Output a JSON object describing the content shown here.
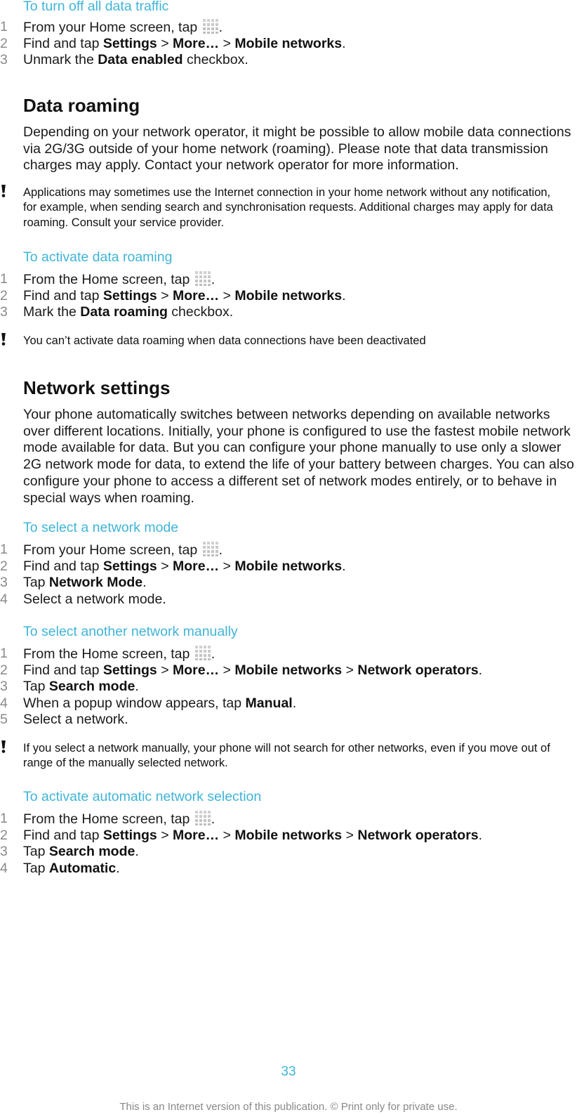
{
  "sections": {
    "turn_off": {
      "title": "To turn off all data traffic",
      "steps": [
        {
          "num": "1",
          "parts": [
            {
              "t": "From your Home screen, tap "
            },
            {
              "icon": "apps"
            },
            {
              "t": "."
            }
          ]
        },
        {
          "num": "2",
          "parts": [
            {
              "t": "Find and tap "
            },
            {
              "b": "Settings"
            },
            {
              "t": " > "
            },
            {
              "b": "More…"
            },
            {
              "t": " > "
            },
            {
              "b": "Mobile networks"
            },
            {
              "t": "."
            }
          ]
        },
        {
          "num": "3",
          "parts": [
            {
              "t": "Unmark the "
            },
            {
              "b": "Data enabled"
            },
            {
              "t": " checkbox."
            }
          ]
        }
      ]
    },
    "data_roaming": {
      "heading": "Data roaming",
      "paragraph": "Depending on your network operator, it might be possible to allow mobile data connections via 2G/3G outside of your home network (roaming). Please note that data transmission charges may apply. Contact your network operator for more information.",
      "note": "Applications may sometimes use the Internet connection in your home network without any notification, for example, when sending search and synchronisation requests. Additional charges may apply for data roaming. Consult your service provider."
    },
    "activate_roaming": {
      "title": "To activate data roaming",
      "steps": [
        {
          "num": "1",
          "parts": [
            {
              "t": "From the Home screen, tap "
            },
            {
              "icon": "apps"
            },
            {
              "t": "."
            }
          ]
        },
        {
          "num": "2",
          "parts": [
            {
              "t": "Find and tap "
            },
            {
              "b": "Settings"
            },
            {
              "t": " > "
            },
            {
              "b": "More…"
            },
            {
              "t": " > "
            },
            {
              "b": "Mobile networks"
            },
            {
              "t": "."
            }
          ]
        },
        {
          "num": "3",
          "parts": [
            {
              "t": "Mark the "
            },
            {
              "b": "Data roaming"
            },
            {
              "t": " checkbox."
            }
          ]
        }
      ],
      "note": "You can’t activate data roaming when data connections have been deactivated"
    },
    "network_settings": {
      "heading": "Network settings",
      "paragraph": "Your phone automatically switches between networks depending on available networks over different locations. Initially, your phone is configured to use the fastest mobile network mode available for data. But you can configure your phone manually to use only a slower 2G network mode for data, to extend the life of your battery between charges. You can also configure your phone to access a different set of network modes entirely, or to behave in special ways when roaming."
    },
    "select_mode": {
      "title": "To select a network mode",
      "steps": [
        {
          "num": "1",
          "parts": [
            {
              "t": "From your Home screen, tap "
            },
            {
              "icon": "apps"
            },
            {
              "t": "."
            }
          ]
        },
        {
          "num": "2",
          "parts": [
            {
              "t": "Find and tap "
            },
            {
              "b": "Settings"
            },
            {
              "t": " > "
            },
            {
              "b": "More…"
            },
            {
              "t": " > "
            },
            {
              "b": "Mobile networks"
            },
            {
              "t": "."
            }
          ]
        },
        {
          "num": "3",
          "parts": [
            {
              "t": "Tap "
            },
            {
              "b": "Network Mode"
            },
            {
              "t": "."
            }
          ]
        },
        {
          "num": "4",
          "parts": [
            {
              "t": "Select a network mode."
            }
          ]
        }
      ]
    },
    "select_manual": {
      "title": "To select another network manually",
      "steps": [
        {
          "num": "1",
          "parts": [
            {
              "t": "From the Home screen, tap "
            },
            {
              "icon": "apps"
            },
            {
              "t": "."
            }
          ]
        },
        {
          "num": "2",
          "parts": [
            {
              "t": "Find and tap "
            },
            {
              "b": "Settings"
            },
            {
              "t": " > "
            },
            {
              "b": "More…"
            },
            {
              "t": " > "
            },
            {
              "b": "Mobile networks"
            },
            {
              "t": " > "
            },
            {
              "b": "Network operators"
            },
            {
              "t": "."
            }
          ]
        },
        {
          "num": "3",
          "parts": [
            {
              "t": "Tap "
            },
            {
              "b": "Search mode"
            },
            {
              "t": "."
            }
          ]
        },
        {
          "num": "4",
          "parts": [
            {
              "t": "When a popup window appears, tap "
            },
            {
              "b": "Manual"
            },
            {
              "t": "."
            }
          ]
        },
        {
          "num": "5",
          "parts": [
            {
              "t": "Select a network."
            }
          ]
        }
      ],
      "note": "If you select a network manually, your phone will not search for other networks, even if you move out of range of the manually selected network."
    },
    "auto_selection": {
      "title": "To activate automatic network selection",
      "steps": [
        {
          "num": "1",
          "parts": [
            {
              "t": "From the Home screen, tap "
            },
            {
              "icon": "apps"
            },
            {
              "t": "."
            }
          ]
        },
        {
          "num": "2",
          "parts": [
            {
              "t": "Find and tap "
            },
            {
              "b": "Settings"
            },
            {
              "t": " > "
            },
            {
              "b": "More…"
            },
            {
              "t": " > "
            },
            {
              "b": "Mobile networks"
            },
            {
              "t": " > "
            },
            {
              "b": "Network operators"
            },
            {
              "t": "."
            }
          ]
        },
        {
          "num": "3",
          "parts": [
            {
              "t": "Tap "
            },
            {
              "b": "Search mode"
            },
            {
              "t": "."
            }
          ]
        },
        {
          "num": "4",
          "parts": [
            {
              "t": "Tap "
            },
            {
              "b": "Automatic"
            },
            {
              "t": "."
            }
          ]
        }
      ]
    }
  },
  "footer": {
    "page_number": "33",
    "notice": "This is an Internet version of this publication. © Print only for private use."
  },
  "colors": {
    "accent": "#3fb4d8",
    "step_number": "#8a8a8a",
    "footer_text": "#888888"
  },
  "icons": {
    "apps": "apps-grid-icon",
    "note": "exclamation-icon"
  }
}
